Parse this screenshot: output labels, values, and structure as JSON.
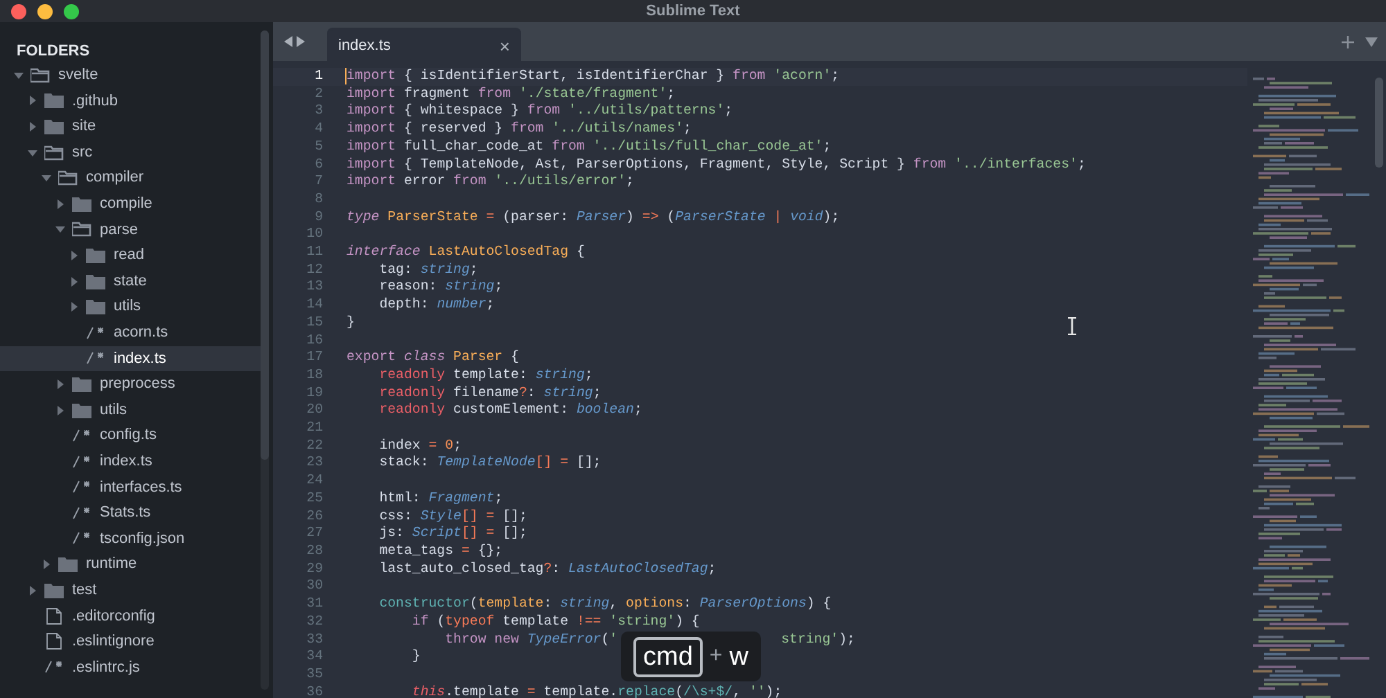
{
  "window": {
    "title": "Sublime Text"
  },
  "sidebar": {
    "heading": "FOLDERS",
    "items": [
      {
        "name": "svelte",
        "kind": "folder",
        "expanded": true,
        "selected": false,
        "children": [
          {
            "name": ".github",
            "kind": "folder",
            "expanded": false,
            "selected": false
          },
          {
            "name": "site",
            "kind": "folder",
            "expanded": false,
            "selected": false
          },
          {
            "name": "src",
            "kind": "folder",
            "expanded": true,
            "selected": false,
            "children": [
              {
                "name": "compiler",
                "kind": "folder",
                "expanded": true,
                "selected": false,
                "children": [
                  {
                    "name": "compile",
                    "kind": "folder",
                    "expanded": false,
                    "selected": false
                  },
                  {
                    "name": "parse",
                    "kind": "folder",
                    "expanded": true,
                    "selected": false,
                    "children": [
                      {
                        "name": "read",
                        "kind": "folder",
                        "expanded": false,
                        "selected": false
                      },
                      {
                        "name": "state",
                        "kind": "folder",
                        "expanded": false,
                        "selected": false
                      },
                      {
                        "name": "utils",
                        "kind": "folder",
                        "expanded": false,
                        "selected": false
                      },
                      {
                        "name": "acorn.ts",
                        "kind": "code",
                        "selected": false
                      },
                      {
                        "name": "index.ts",
                        "kind": "code",
                        "selected": true
                      }
                    ]
                  },
                  {
                    "name": "preprocess",
                    "kind": "folder",
                    "expanded": false,
                    "selected": false
                  },
                  {
                    "name": "utils",
                    "kind": "folder",
                    "expanded": false,
                    "selected": false
                  },
                  {
                    "name": "config.ts",
                    "kind": "code",
                    "selected": false
                  },
                  {
                    "name": "index.ts",
                    "kind": "code",
                    "selected": false
                  },
                  {
                    "name": "interfaces.ts",
                    "kind": "code",
                    "selected": false
                  },
                  {
                    "name": "Stats.ts",
                    "kind": "code",
                    "selected": false
                  },
                  {
                    "name": "tsconfig.json",
                    "kind": "code",
                    "selected": false
                  }
                ]
              },
              {
                "name": "runtime",
                "kind": "folder",
                "expanded": false,
                "selected": false
              }
            ]
          },
          {
            "name": "test",
            "kind": "folder",
            "expanded": false,
            "selected": false
          },
          {
            "name": ".editorconfig",
            "kind": "file",
            "selected": false
          },
          {
            "name": ".eslintignore",
            "kind": "file",
            "selected": false
          },
          {
            "name": ".eslintrc.js",
            "kind": "code",
            "selected": false
          }
        ]
      }
    ]
  },
  "tabs": [
    {
      "label": "index.ts",
      "close": "×",
      "selected": true
    }
  ],
  "editor": {
    "lines": [
      {
        "number": "1",
        "current": true,
        "tokens": [
          {
            "text": "import",
            "kind": "keyword"
          },
          {
            "text": " { isIdentifierStart, isIdentifierChar } ",
            "kind": "plain"
          },
          {
            "text": "from",
            "kind": "keyword"
          },
          {
            "text": " 'acorn'",
            "kind": "string"
          },
          {
            "text": ";",
            "kind": "plain"
          }
        ]
      },
      {
        "number": "2",
        "current": false,
        "tokens": [
          {
            "text": "import",
            "kind": "keyword"
          },
          {
            "text": " fragment ",
            "kind": "plain"
          },
          {
            "text": "from",
            "kind": "keyword"
          },
          {
            "text": " './state/fragment'",
            "kind": "string"
          },
          {
            "text": ";",
            "kind": "plain"
          }
        ]
      },
      {
        "number": "3",
        "current": false,
        "tokens": [
          {
            "text": "import",
            "kind": "keyword"
          },
          {
            "text": " { whitespace } ",
            "kind": "plain"
          },
          {
            "text": "from",
            "kind": "keyword"
          },
          {
            "text": " '../utils/patterns'",
            "kind": "string"
          },
          {
            "text": ";",
            "kind": "plain"
          }
        ]
      },
      {
        "number": "4",
        "current": false,
        "tokens": [
          {
            "text": "import",
            "kind": "keyword"
          },
          {
            "text": " { reserved } ",
            "kind": "plain"
          },
          {
            "text": "from",
            "kind": "keyword"
          },
          {
            "text": " '../utils/names'",
            "kind": "string"
          },
          {
            "text": ";",
            "kind": "plain"
          }
        ]
      },
      {
        "number": "5",
        "current": false,
        "tokens": [
          {
            "text": "import",
            "kind": "keyword"
          },
          {
            "text": " full_char_code_at ",
            "kind": "plain"
          },
          {
            "text": "from",
            "kind": "keyword"
          },
          {
            "text": " '../utils/full_char_code_at'",
            "kind": "string"
          },
          {
            "text": ";",
            "kind": "plain"
          }
        ]
      },
      {
        "number": "6",
        "current": false,
        "tokens": [
          {
            "text": "import",
            "kind": "keyword"
          },
          {
            "text": " { TemplateNode, Ast, ParserOptions, Fragment, Style, Script } ",
            "kind": "plain"
          },
          {
            "text": "from",
            "kind": "keyword"
          },
          {
            "text": " '../interfaces'",
            "kind": "string"
          },
          {
            "text": ";",
            "kind": "plain"
          }
        ]
      },
      {
        "number": "7",
        "current": false,
        "tokens": [
          {
            "text": "import",
            "kind": "keyword"
          },
          {
            "text": " error ",
            "kind": "plain"
          },
          {
            "text": "from",
            "kind": "keyword"
          },
          {
            "text": " '../utils/error'",
            "kind": "string"
          },
          {
            "text": ";",
            "kind": "plain"
          }
        ]
      },
      {
        "number": "8",
        "current": false
      },
      {
        "number": "9",
        "current": false,
        "tokens": [
          {
            "text": "type",
            "kind": "storage"
          },
          {
            "text": " ParserState",
            "kind": "classname"
          },
          {
            "text": " =",
            "kind": "operator"
          },
          {
            "text": " (parser: ",
            "kind": "plain"
          },
          {
            "text": "Parser",
            "kind": "type"
          },
          {
            "text": ") ",
            "kind": "plain"
          },
          {
            "text": "=>",
            "kind": "operator"
          },
          {
            "text": " (",
            "kind": "plain"
          },
          {
            "text": "ParserState",
            "kind": "type"
          },
          {
            "text": " |",
            "kind": "operator"
          },
          {
            "text": " void",
            "kind": "type"
          },
          {
            "text": ");",
            "kind": "plain"
          }
        ]
      },
      {
        "number": "10",
        "current": false
      },
      {
        "number": "11",
        "current": false,
        "tokens": [
          {
            "text": "interface",
            "kind": "storage"
          },
          {
            "text": " LastAutoClosedTag",
            "kind": "classname"
          },
          {
            "text": " {",
            "kind": "plain"
          }
        ]
      },
      {
        "number": "12",
        "current": false,
        "tokens": [
          {
            "text": "    tag: ",
            "kind": "plain"
          },
          {
            "text": "string",
            "kind": "type"
          },
          {
            "text": ";",
            "kind": "plain"
          }
        ]
      },
      {
        "number": "13",
        "current": false,
        "tokens": [
          {
            "text": "    reason: ",
            "kind": "plain"
          },
          {
            "text": "string",
            "kind": "type"
          },
          {
            "text": ";",
            "kind": "plain"
          }
        ]
      },
      {
        "number": "14",
        "current": false,
        "tokens": [
          {
            "text": "    depth: ",
            "kind": "plain"
          },
          {
            "text": "number",
            "kind": "type"
          },
          {
            "text": ";",
            "kind": "plain"
          }
        ]
      },
      {
        "number": "15",
        "current": false,
        "tokens": [
          {
            "text": "}",
            "kind": "plain"
          }
        ]
      },
      {
        "number": "16",
        "current": false
      },
      {
        "number": "17",
        "current": false,
        "tokens": [
          {
            "text": "export",
            "kind": "keyword"
          },
          {
            "text": " class",
            "kind": "storage"
          },
          {
            "text": " Parser",
            "kind": "classname"
          },
          {
            "text": " {",
            "kind": "plain"
          }
        ]
      },
      {
        "number": "18",
        "current": false,
        "tokens": [
          {
            "text": "    readonly",
            "kind": "modifier"
          },
          {
            "text": " template: ",
            "kind": "plain"
          },
          {
            "text": "string",
            "kind": "type"
          },
          {
            "text": ";",
            "kind": "plain"
          }
        ]
      },
      {
        "number": "19",
        "current": false,
        "tokens": [
          {
            "text": "    readonly",
            "kind": "modifier"
          },
          {
            "text": " filename",
            "kind": "plain"
          },
          {
            "text": "?",
            "kind": "operator"
          },
          {
            "text": ": ",
            "kind": "plain"
          },
          {
            "text": "string",
            "kind": "type"
          },
          {
            "text": ";",
            "kind": "plain"
          }
        ]
      },
      {
        "number": "20",
        "current": false,
        "tokens": [
          {
            "text": "    readonly",
            "kind": "modifier"
          },
          {
            "text": " customElement: ",
            "kind": "plain"
          },
          {
            "text": "boolean",
            "kind": "type"
          },
          {
            "text": ";",
            "kind": "plain"
          }
        ]
      },
      {
        "number": "21",
        "current": false
      },
      {
        "number": "22",
        "current": false,
        "tokens": [
          {
            "text": "    index ",
            "kind": "plain"
          },
          {
            "text": "=",
            "kind": "operator"
          },
          {
            "text": " 0",
            "kind": "number"
          },
          {
            "text": ";",
            "kind": "plain"
          }
        ]
      },
      {
        "number": "23",
        "current": false,
        "tokens": [
          {
            "text": "    stack: ",
            "kind": "plain"
          },
          {
            "text": "TemplateNode",
            "kind": "type"
          },
          {
            "text": "[] =",
            "kind": "operator"
          },
          {
            "text": " [];",
            "kind": "plain"
          }
        ]
      },
      {
        "number": "24",
        "current": false
      },
      {
        "number": "25",
        "current": false,
        "tokens": [
          {
            "text": "    html: ",
            "kind": "plain"
          },
          {
            "text": "Fragment",
            "kind": "type"
          },
          {
            "text": ";",
            "kind": "plain"
          }
        ]
      },
      {
        "number": "26",
        "current": false,
        "tokens": [
          {
            "text": "    css: ",
            "kind": "plain"
          },
          {
            "text": "Style",
            "kind": "type"
          },
          {
            "text": "[] =",
            "kind": "operator"
          },
          {
            "text": " [];",
            "kind": "plain"
          }
        ]
      },
      {
        "number": "27",
        "current": false,
        "tokens": [
          {
            "text": "    js: ",
            "kind": "plain"
          },
          {
            "text": "Script",
            "kind": "type"
          },
          {
            "text": "[] =",
            "kind": "operator"
          },
          {
            "text": " [];",
            "kind": "plain"
          }
        ]
      },
      {
        "number": "28",
        "current": false,
        "tokens": [
          {
            "text": "    meta_tags ",
            "kind": "plain"
          },
          {
            "text": "=",
            "kind": "operator"
          },
          {
            "text": " {};",
            "kind": "plain"
          }
        ]
      },
      {
        "number": "29",
        "current": false,
        "tokens": [
          {
            "text": "    last_auto_closed_tag",
            "kind": "plain"
          },
          {
            "text": "?",
            "kind": "operator"
          },
          {
            "text": ": ",
            "kind": "plain"
          },
          {
            "text": "LastAutoClosedTag",
            "kind": "type"
          },
          {
            "text": ";",
            "kind": "plain"
          }
        ]
      },
      {
        "number": "30",
        "current": false
      },
      {
        "number": "31",
        "current": false,
        "tokens": [
          {
            "text": "    constructor",
            "kind": "call"
          },
          {
            "text": "(",
            "kind": "plain"
          },
          {
            "text": "template",
            "kind": "classname"
          },
          {
            "text": ": ",
            "kind": "plain"
          },
          {
            "text": "string",
            "kind": "type"
          },
          {
            "text": ", ",
            "kind": "plain"
          },
          {
            "text": "options",
            "kind": "classname"
          },
          {
            "text": ": ",
            "kind": "plain"
          },
          {
            "text": "ParserOptions",
            "kind": "type"
          },
          {
            "text": ") {",
            "kind": "plain"
          }
        ]
      },
      {
        "number": "32",
        "current": false,
        "tokens": [
          {
            "text": "        if",
            "kind": "keyword"
          },
          {
            "text": " (",
            "kind": "plain"
          },
          {
            "text": "typeof",
            "kind": "operator"
          },
          {
            "text": " template ",
            "kind": "plain"
          },
          {
            "text": "!==",
            "kind": "operator"
          },
          {
            "text": " 'string'",
            "kind": "string"
          },
          {
            "text": ") {",
            "kind": "plain"
          }
        ]
      },
      {
        "number": "33",
        "current": false,
        "tokens": [
          {
            "text": "            throw new",
            "kind": "keyword"
          },
          {
            "text": " TypeError",
            "kind": "type"
          },
          {
            "text": "(",
            "kind": "plain"
          },
          {
            "text": "'",
            "kind": "string"
          }
        ],
        "after_overlay": [
          {
            "text": "string'",
            "kind": "string"
          },
          {
            "text": ");",
            "kind": "plain"
          }
        ]
      },
      {
        "number": "34",
        "current": false,
        "tokens": [
          {
            "text": "        }",
            "kind": "plain"
          }
        ]
      },
      {
        "number": "35",
        "current": false
      },
      {
        "number": "36",
        "current": false,
        "tokens": [
          {
            "text": "        this",
            "kind": "self"
          },
          {
            "text": ".template ",
            "kind": "plain"
          },
          {
            "text": "=",
            "kind": "operator"
          },
          {
            "text": " template.",
            "kind": "plain"
          },
          {
            "text": "replace",
            "kind": "call"
          },
          {
            "text": "(",
            "kind": "plain"
          },
          {
            "text": "/\\s+$/",
            "kind": "call"
          },
          {
            "text": ", ",
            "kind": "plain"
          },
          {
            "text": "''",
            "kind": "string"
          },
          {
            "text": ");",
            "kind": "plain"
          }
        ]
      }
    ]
  },
  "keystroke": {
    "keys": [
      "cmd",
      "w"
    ],
    "joiner": "+"
  }
}
